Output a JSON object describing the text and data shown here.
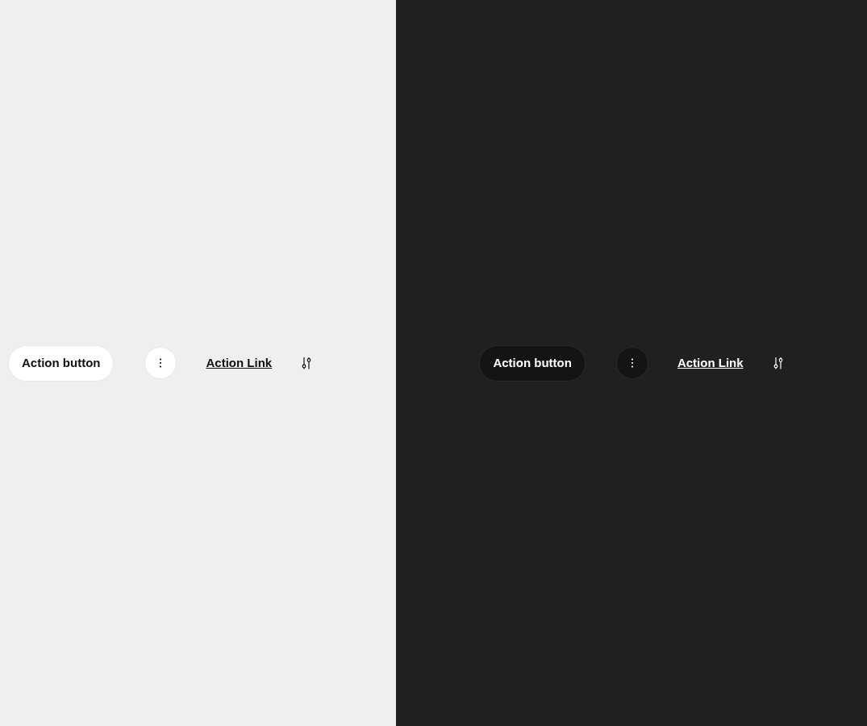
{
  "panels": [
    {
      "dark": false,
      "centered": false,
      "button": {
        "label": "Action button"
      },
      "link": {
        "label": "Action Link"
      }
    },
    {
      "dark": true,
      "centered": true,
      "button": {
        "label": "Action button"
      },
      "link": {
        "label": "Action Link"
      }
    }
  ]
}
